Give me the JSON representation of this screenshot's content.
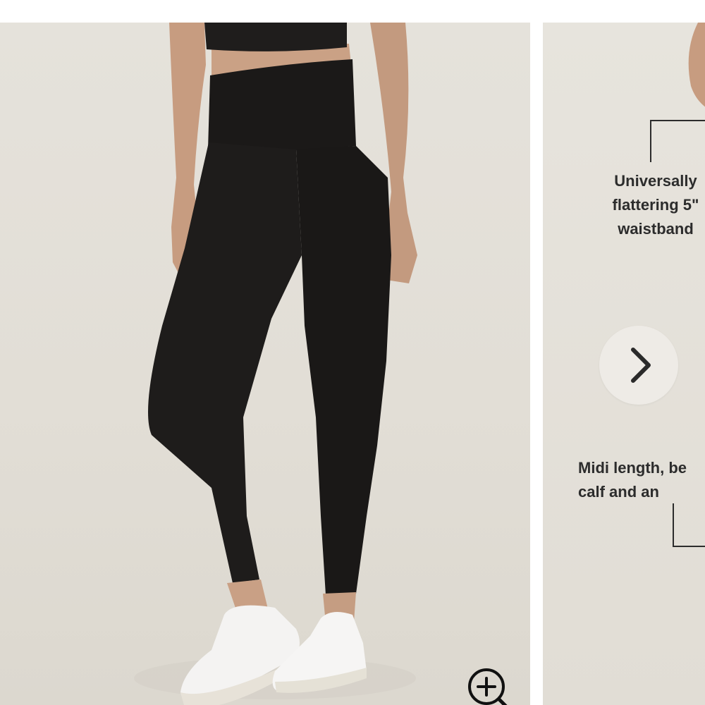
{
  "gallery": {
    "slide_1": {
      "image_subject": "leggings-model-photo"
    },
    "slide_2": {
      "callout_top": "Universally\nflattering 5\"\nwaistband",
      "callout_bottom": "Midi length, be\n  calf and an"
    }
  },
  "icons": {
    "zoom": "zoom-in-icon",
    "next": "chevron-right-icon"
  },
  "colors": {
    "background": "#e3dfd8",
    "legging": "#1c1a19",
    "text": "#2c2c2c",
    "button": "#eeebe6"
  }
}
